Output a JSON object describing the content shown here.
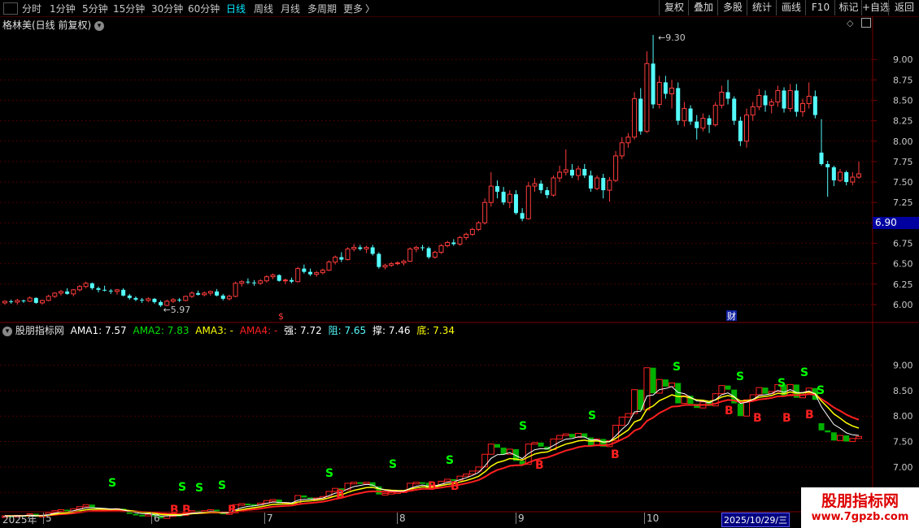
{
  "toolbar": {
    "periods": [
      {
        "label": "分时"
      },
      {
        "label": "1分钟"
      },
      {
        "label": "5分钟"
      },
      {
        "label": "15分钟"
      },
      {
        "label": "30分钟"
      },
      {
        "label": "60分钟"
      },
      {
        "label": "日线"
      },
      {
        "label": "周线"
      },
      {
        "label": "月线"
      },
      {
        "label": "多周期"
      },
      {
        "label": "更多"
      }
    ],
    "active_period": "日线",
    "more_arrow": "〉",
    "right_buttons": [
      {
        "label": "复权"
      },
      {
        "label": "叠加"
      },
      {
        "label": "多股"
      },
      {
        "label": "统计"
      },
      {
        "label": "画线"
      },
      {
        "label": "F10"
      },
      {
        "label": "标记"
      },
      {
        "label": "+自选"
      },
      {
        "label": "返回"
      }
    ]
  },
  "main_chart": {
    "stock_title": "格林美(日线 前复权)",
    "price_ticks": [
      "9.00",
      "8.75",
      "8.50",
      "8.25",
      "8.00",
      "7.75",
      "7.50",
      "7.25",
      "7.00",
      "6.75",
      "6.50",
      "6.25",
      "6.00"
    ],
    "current_price_tag": "6.90",
    "high_annotation": "9.30",
    "low_annotation": "5.97",
    "event_marker_s": "$",
    "event_marker_cai": "财"
  },
  "indicator": {
    "name": "股朋指标网",
    "ama1_label": "AMA1: ",
    "ama1_value": "7.57",
    "ama2_label": "AMA2: ",
    "ama2_value": "7.83",
    "ama3_label": "AMA3: ",
    "ama3_value": "-",
    "ama4_label": "AMA4: ",
    "ama4_value": "-",
    "qiang_label": "强: ",
    "qiang_value": "7.72",
    "zu_label": "阻: ",
    "zu_value": "7.65",
    "cheng_label": "撑: ",
    "cheng_value": "7.46",
    "di_label": "底: ",
    "di_value": "7.34",
    "price_ticks": [
      "9.00",
      "8.50",
      "8.00",
      "7.50",
      "7.00",
      "6.50"
    ],
    "signal_s": "S",
    "signal_b": "B"
  },
  "time_axis": {
    "year_label": "2025年",
    "months": [
      "5",
      "6",
      "7",
      "8",
      "9",
      "10"
    ],
    "cursor_date": "2025/10/29/三"
  },
  "watermark": {
    "title": "股朋指标网",
    "url": "www.7gpzb.com"
  },
  "colors": {
    "up": "#ff3c3c",
    "down": "#54fcfc",
    "grid": "#5a0000",
    "axis_text": "#c8c8c8",
    "ama1": "#ffffff",
    "ama2": "#00e000",
    "ama3": "#ffff00",
    "ama4": "#ff2020",
    "signal_s": "#00ff00",
    "signal_b": "#ff2020"
  },
  "chart_data": {
    "type": "candlestick",
    "title": "格林美(日线 前复权)",
    "y_range": [
      5.8,
      9.45
    ],
    "ohlc": [
      [
        6.02,
        6.05,
        6.0,
        6.04
      ],
      [
        6.04,
        6.06,
        6.01,
        6.03
      ],
      [
        6.03,
        6.07,
        6.0,
        6.05
      ],
      [
        6.05,
        6.06,
        6.02,
        6.04
      ],
      [
        6.04,
        6.1,
        6.03,
        6.08
      ],
      [
        6.08,
        6.09,
        6.01,
        6.02
      ],
      [
        6.02,
        6.06,
        6.0,
        6.05
      ],
      [
        6.05,
        6.12,
        6.04,
        6.1
      ],
      [
        6.1,
        6.15,
        6.08,
        6.14
      ],
      [
        6.14,
        6.18,
        6.11,
        6.16
      ],
      [
        6.16,
        6.2,
        6.12,
        6.13
      ],
      [
        6.13,
        6.19,
        6.1,
        6.18
      ],
      [
        6.18,
        6.24,
        6.16,
        6.22
      ],
      [
        6.22,
        6.28,
        6.2,
        6.26
      ],
      [
        6.26,
        6.27,
        6.18,
        6.2
      ],
      [
        6.2,
        6.22,
        6.15,
        6.18
      ],
      [
        6.18,
        6.23,
        6.16,
        6.17
      ],
      [
        6.17,
        6.19,
        6.13,
        6.16
      ],
      [
        6.16,
        6.19,
        6.12,
        6.18
      ],
      [
        6.18,
        6.2,
        6.1,
        6.11
      ],
      [
        6.11,
        6.13,
        6.06,
        6.08
      ],
      [
        6.08,
        6.1,
        6.04,
        6.06
      ],
      [
        6.06,
        6.08,
        6.02,
        6.05
      ],
      [
        6.05,
        6.09,
        6.03,
        6.07
      ],
      [
        6.07,
        6.08,
        6.01,
        6.03
      ],
      [
        6.03,
        6.05,
        5.97,
        5.99
      ],
      [
        5.99,
        6.06,
        5.98,
        6.04
      ],
      [
        6.04,
        6.08,
        6.02,
        6.06
      ],
      [
        6.06,
        6.08,
        6.03,
        6.05
      ],
      [
        6.05,
        6.11,
        6.04,
        6.1
      ],
      [
        6.1,
        6.16,
        6.08,
        6.14
      ],
      [
        6.14,
        6.17,
        6.11,
        6.12
      ],
      [
        6.12,
        6.16,
        6.1,
        6.14
      ],
      [
        6.14,
        6.17,
        6.11,
        6.16
      ],
      [
        6.16,
        6.19,
        6.1,
        6.11
      ],
      [
        6.11,
        6.13,
        6.05,
        6.07
      ],
      [
        6.07,
        6.12,
        6.05,
        6.1
      ],
      [
        6.1,
        6.28,
        6.09,
        6.26
      ],
      [
        6.26,
        6.3,
        6.22,
        6.28
      ],
      [
        6.28,
        6.32,
        6.25,
        6.27
      ],
      [
        6.27,
        6.3,
        6.23,
        6.26
      ],
      [
        6.26,
        6.31,
        6.24,
        6.29
      ],
      [
        6.29,
        6.36,
        6.27,
        6.34
      ],
      [
        6.34,
        6.38,
        6.31,
        6.36
      ],
      [
        6.36,
        6.37,
        6.28,
        6.29
      ],
      [
        6.29,
        6.32,
        6.25,
        6.3
      ],
      [
        6.3,
        6.33,
        6.26,
        6.28
      ],
      [
        6.28,
        6.46,
        6.27,
        6.44
      ],
      [
        6.44,
        6.49,
        6.38,
        6.4
      ],
      [
        6.4,
        6.44,
        6.35,
        6.37
      ],
      [
        6.37,
        6.41,
        6.34,
        6.39
      ],
      [
        6.39,
        6.44,
        6.37,
        6.42
      ],
      [
        6.42,
        6.54,
        6.41,
        6.52
      ],
      [
        6.52,
        6.6,
        6.49,
        6.58
      ],
      [
        6.58,
        6.64,
        6.52,
        6.55
      ],
      [
        6.55,
        6.7,
        6.54,
        6.68
      ],
      [
        6.68,
        6.74,
        6.65,
        6.7
      ],
      [
        6.7,
        6.73,
        6.66,
        6.68
      ],
      [
        6.68,
        6.72,
        6.63,
        6.7
      ],
      [
        6.7,
        6.73,
        6.6,
        6.62
      ],
      [
        6.62,
        6.64,
        6.44,
        6.46
      ],
      [
        6.46,
        6.5,
        6.43,
        6.48
      ],
      [
        6.48,
        6.52,
        6.46,
        6.5
      ],
      [
        6.5,
        6.53,
        6.48,
        6.51
      ],
      [
        6.51,
        6.55,
        6.48,
        6.53
      ],
      [
        6.53,
        6.7,
        6.52,
        6.68
      ],
      [
        6.68,
        6.72,
        6.64,
        6.7
      ],
      [
        6.7,
        6.73,
        6.66,
        6.69
      ],
      [
        6.69,
        6.71,
        6.56,
        6.58
      ],
      [
        6.58,
        6.66,
        6.56,
        6.64
      ],
      [
        6.64,
        6.74,
        6.62,
        6.72
      ],
      [
        6.72,
        6.78,
        6.7,
        6.76
      ],
      [
        6.76,
        6.8,
        6.72,
        6.74
      ],
      [
        6.74,
        6.84,
        6.72,
        6.82
      ],
      [
        6.82,
        6.88,
        6.79,
        6.86
      ],
      [
        6.86,
        6.94,
        6.84,
        6.92
      ],
      [
        6.92,
        7.02,
        6.9,
        7.0
      ],
      [
        7.0,
        7.3,
        6.98,
        7.25
      ],
      [
        7.25,
        7.62,
        7.2,
        7.45
      ],
      [
        7.45,
        7.52,
        7.3,
        7.38
      ],
      [
        7.38,
        7.44,
        7.22,
        7.25
      ],
      [
        7.25,
        7.4,
        7.18,
        7.35
      ],
      [
        7.35,
        7.4,
        7.1,
        7.12
      ],
      [
        7.12,
        7.18,
        7.02,
        7.05
      ],
      [
        7.05,
        7.5,
        7.04,
        7.45
      ],
      [
        7.45,
        7.55,
        7.38,
        7.48
      ],
      [
        7.48,
        7.52,
        7.36,
        7.4
      ],
      [
        7.4,
        7.44,
        7.3,
        7.34
      ],
      [
        7.34,
        7.58,
        7.32,
        7.55
      ],
      [
        7.55,
        7.7,
        7.5,
        7.62
      ],
      [
        7.62,
        7.9,
        7.58,
        7.65
      ],
      [
        7.65,
        7.72,
        7.55,
        7.58
      ],
      [
        7.58,
        7.7,
        7.52,
        7.66
      ],
      [
        7.66,
        7.72,
        7.55,
        7.58
      ],
      [
        7.58,
        7.64,
        7.38,
        7.42
      ],
      [
        7.42,
        7.58,
        7.4,
        7.55
      ],
      [
        7.55,
        7.6,
        7.3,
        7.4
      ],
      [
        7.4,
        7.56,
        7.26,
        7.52
      ],
      [
        7.52,
        7.88,
        7.5,
        7.82
      ],
      [
        7.82,
        8.05,
        7.78,
        7.98
      ],
      [
        7.98,
        8.1,
        7.92,
        8.05
      ],
      [
        8.05,
        8.6,
        8.02,
        8.52
      ],
      [
        8.52,
        8.65,
        8.08,
        8.12
      ],
      [
        8.12,
        9.1,
        8.1,
        8.95
      ],
      [
        8.95,
        9.3,
        8.4,
        8.45
      ],
      [
        8.45,
        8.8,
        8.4,
        8.72
      ],
      [
        8.72,
        8.8,
        8.52,
        8.58
      ],
      [
        8.58,
        8.75,
        8.4,
        8.65
      ],
      [
        8.65,
        8.72,
        8.2,
        8.25
      ],
      [
        8.25,
        8.48,
        8.18,
        8.4
      ],
      [
        8.4,
        8.44,
        8.2,
        8.24
      ],
      [
        8.24,
        8.32,
        8.02,
        8.16
      ],
      [
        8.16,
        8.34,
        8.12,
        8.28
      ],
      [
        8.28,
        8.32,
        8.1,
        8.2
      ],
      [
        8.2,
        8.48,
        8.18,
        8.44
      ],
      [
        8.44,
        8.68,
        8.4,
        8.6
      ],
      [
        8.6,
        8.75,
        8.45,
        8.52
      ],
      [
        8.52,
        8.55,
        8.2,
        8.25
      ],
      [
        8.25,
        8.3,
        7.94,
        8.0
      ],
      [
        8.0,
        8.4,
        7.92,
        8.32
      ],
      [
        8.32,
        8.48,
        8.25,
        8.42
      ],
      [
        8.42,
        8.64,
        8.38,
        8.56
      ],
      [
        8.56,
        8.62,
        8.36,
        8.44
      ],
      [
        8.44,
        8.52,
        8.34,
        8.48
      ],
      [
        8.48,
        8.68,
        8.42,
        8.62
      ],
      [
        8.62,
        8.66,
        8.35,
        8.4
      ],
      [
        8.4,
        8.7,
        8.36,
        8.62
      ],
      [
        8.62,
        8.7,
        8.3,
        8.36
      ],
      [
        8.36,
        8.52,
        8.3,
        8.46
      ],
      [
        8.46,
        8.72,
        8.4,
        8.55
      ],
      [
        8.55,
        8.62,
        8.28,
        8.32
      ],
      [
        7.86,
        8.27,
        7.7,
        7.72
      ],
      [
        7.72,
        7.76,
        7.32,
        7.68
      ],
      [
        7.68,
        7.7,
        7.45,
        7.52
      ],
      [
        7.52,
        7.66,
        7.5,
        7.62
      ],
      [
        7.62,
        7.64,
        7.46,
        7.5
      ],
      [
        7.5,
        7.62,
        7.46,
        7.56
      ],
      [
        7.56,
        7.75,
        7.54,
        7.6
      ]
    ],
    "ama_indicator": {
      "ama1_last": 7.57,
      "ama2_last": 7.83,
      "y_range": [
        6.2,
        9.6
      ]
    }
  }
}
